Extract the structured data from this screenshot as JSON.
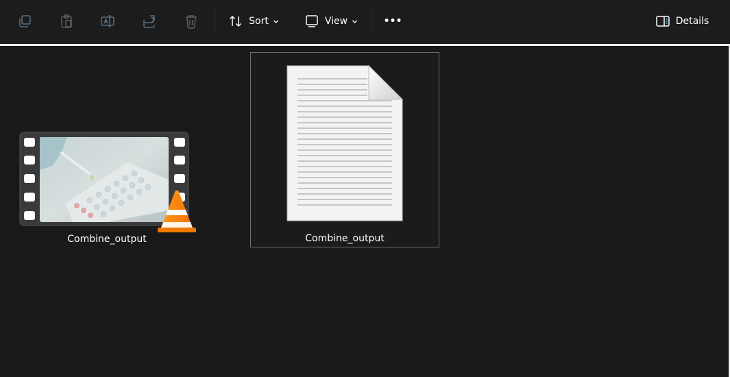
{
  "toolbar": {
    "copy_icon": "copy-icon",
    "paste_icon": "paste-icon",
    "rename_icon": "rename-icon",
    "share_icon": "share-icon",
    "delete_icon": "delete-icon",
    "sort_label": "Sort",
    "view_label": "View",
    "more_label": "•••",
    "details_label": "Details"
  },
  "files": [
    {
      "name": "Combine_output",
      "type": "video",
      "overlay_icon": "vlc-cone-icon"
    },
    {
      "name": "Combine_output",
      "type": "text-document",
      "selected": true
    }
  ],
  "colors": {
    "background": "#191919",
    "accent_blue": "#60cdff",
    "vlc_orange": "#ff8800"
  }
}
